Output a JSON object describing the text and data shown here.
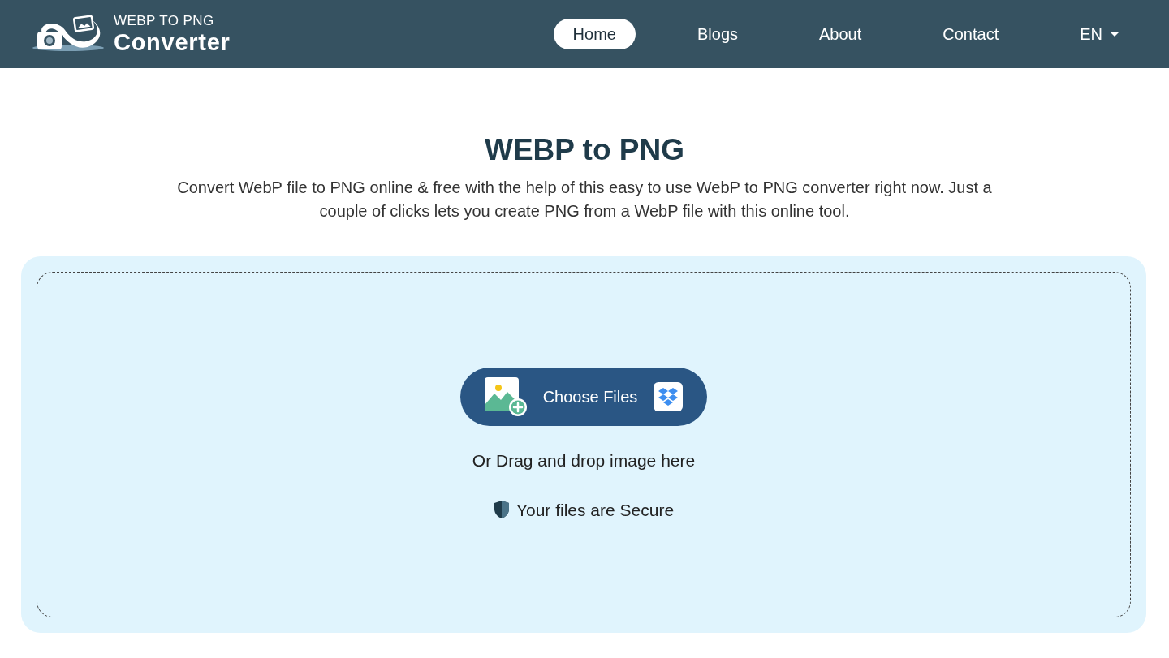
{
  "header": {
    "logo": {
      "line_1": "WEBP TO PNG",
      "line_2": "Converter"
    },
    "nav": [
      {
        "label": "Home",
        "selected": true
      },
      {
        "label": "Blogs",
        "selected": false
      },
      {
        "label": "About",
        "selected": false
      },
      {
        "label": "Contact",
        "selected": false
      }
    ],
    "language": {
      "label": "EN"
    }
  },
  "hero": {
    "title": "WEBP to PNG",
    "description": "Convert WebP file to PNG online & free with the help of this easy to use WebP to PNG converter right now. Just a couple of clicks lets you create PNG from a WebP file with this online tool."
  },
  "upload": {
    "button": "Choose Files",
    "drop_hint": "Or Drag and drop image here",
    "security_note": "Your files are Secure"
  }
}
